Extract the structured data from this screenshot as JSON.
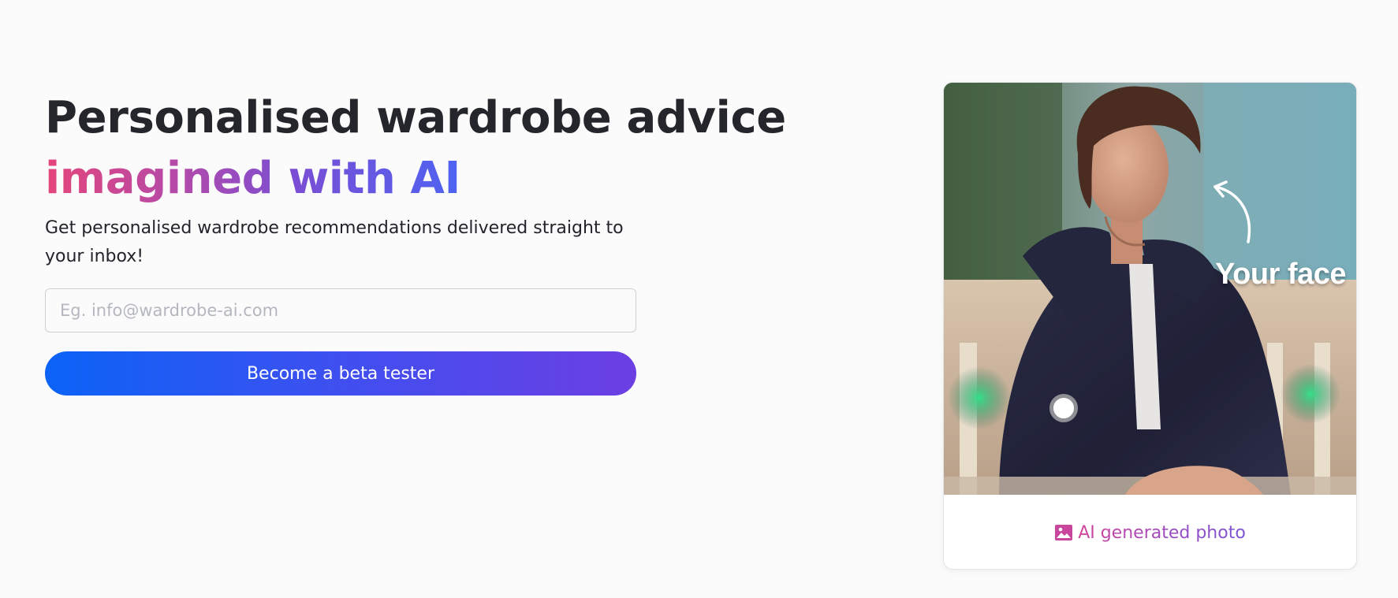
{
  "hero": {
    "title": "Personalised wardrobe advice",
    "title_accent": "imagined with AI",
    "subtitle": "Get personalised wardrobe recommendations delivered straight to your inbox!"
  },
  "signup": {
    "email_placeholder": "Eg. info@wardrobe-ai.com",
    "email_value": "",
    "cta_label": "Become a beta tester"
  },
  "photo_card": {
    "overlay_label": "Your face",
    "caption": "AI generated photo",
    "caption_icon": "image-icon",
    "annotation_icon": "curved-arrow-icon"
  },
  "colors": {
    "background": "#fbfbfc",
    "text": "#25262b",
    "accent_gradient_start": "#e5457a",
    "accent_gradient_end": "#4e63f2",
    "button_gradient_start": "#0b63f6",
    "button_gradient_end": "#6c3fe3",
    "caption_accent": "#c04aa2"
  }
}
